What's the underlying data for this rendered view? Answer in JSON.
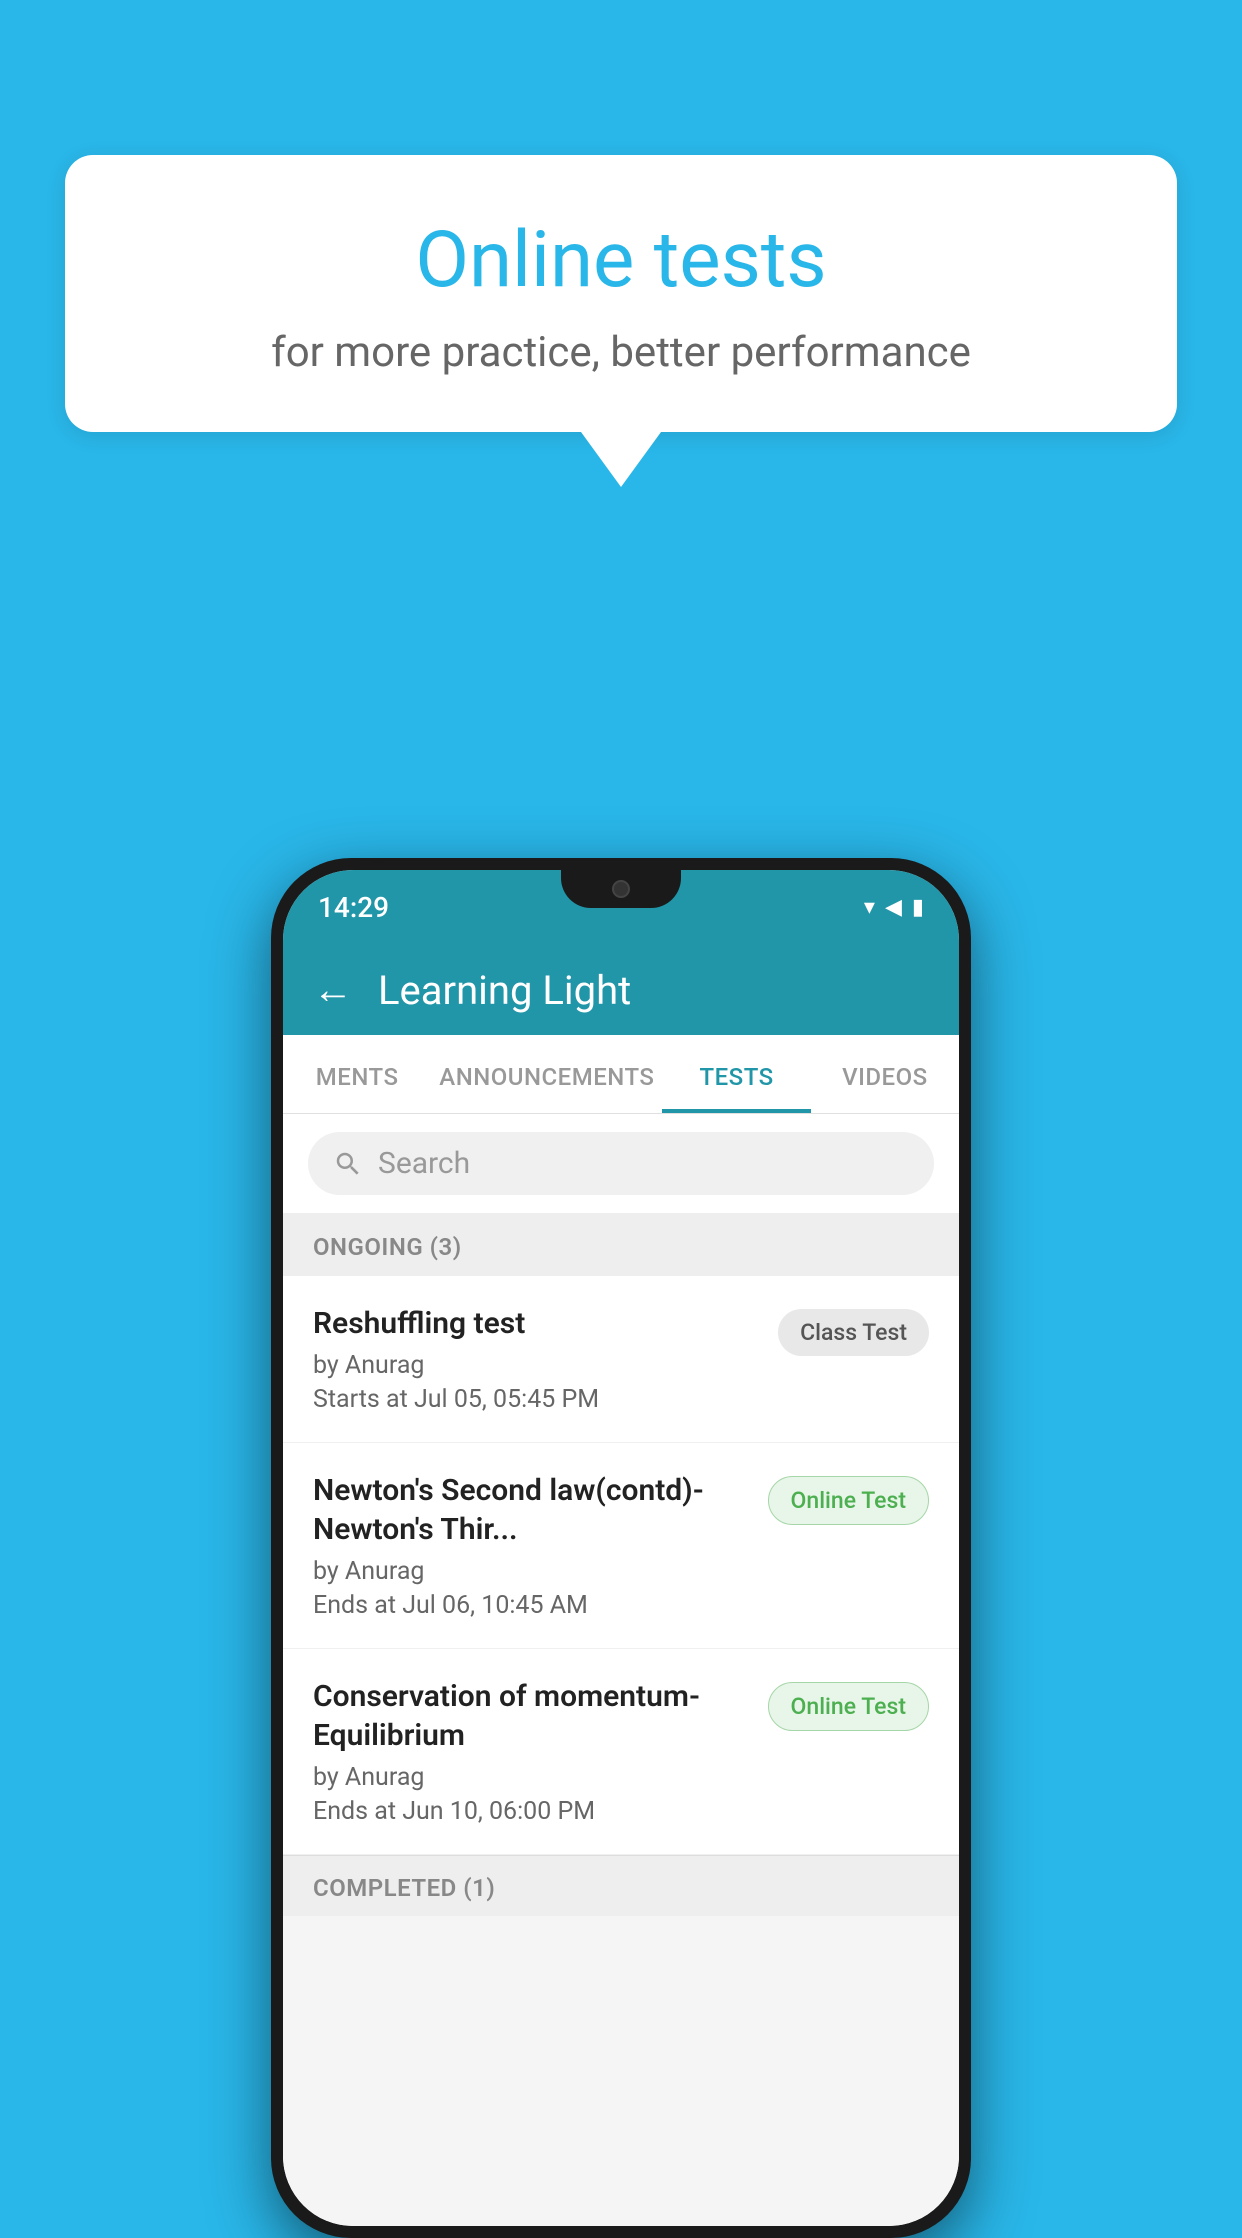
{
  "background_color": "#29b6e8",
  "speech_bubble": {
    "title": "Online tests",
    "subtitle": "for more practice, better performance"
  },
  "phone": {
    "status_bar": {
      "time": "14:29",
      "wifi": "▾",
      "signal": "▲",
      "battery": "▮"
    },
    "header": {
      "back_label": "←",
      "title": "Learning Light"
    },
    "tabs": [
      {
        "label": "MENTS",
        "active": false
      },
      {
        "label": "ANNOUNCEMENTS",
        "active": false
      },
      {
        "label": "TESTS",
        "active": true
      },
      {
        "label": "VIDEOS",
        "active": false
      }
    ],
    "search": {
      "placeholder": "Search"
    },
    "ongoing_section": {
      "title": "ONGOING (3)",
      "items": [
        {
          "name": "Reshuffling test",
          "by": "by Anurag",
          "time": "Starts at  Jul 05, 05:45 PM",
          "badge": "Class Test",
          "badge_type": "class"
        },
        {
          "name": "Newton's Second law(contd)-Newton's Thir...",
          "by": "by Anurag",
          "time": "Ends at  Jul 06, 10:45 AM",
          "badge": "Online Test",
          "badge_type": "online"
        },
        {
          "name": "Conservation of momentum-Equilibrium",
          "by": "by Anurag",
          "time": "Ends at  Jun 10, 06:00 PM",
          "badge": "Online Test",
          "badge_type": "online"
        }
      ]
    },
    "completed_section": {
      "title": "COMPLETED (1)"
    }
  }
}
